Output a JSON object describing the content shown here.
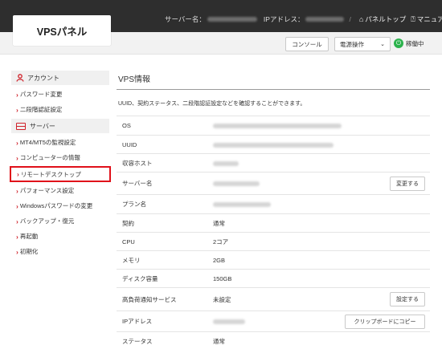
{
  "header": {
    "logo": "VPSパネル",
    "server_name_label": "サーバー名：",
    "ip_label": "IPアドレス：",
    "separator": "/",
    "panel_top_label": "パネルトップ",
    "manual_label": "マニュアル"
  },
  "toolbar": {
    "console_label": "コンソール",
    "power_select_value": "電源操作",
    "status_label": "稼働中",
    "status_color": "#2bb24c"
  },
  "sidebar": {
    "account_heading": "アカウント",
    "account_items": [
      {
        "label": "パスワード変更"
      },
      {
        "label": "二段階認証設定"
      }
    ],
    "server_heading": "サーバー",
    "server_items": [
      {
        "label": "MT4/MT5の監視設定"
      },
      {
        "label": "コンピューターの情報"
      },
      {
        "label": "リモートデスクトップ"
      },
      {
        "label": "パフォーマンス設定"
      },
      {
        "label": "Windowsパスワードの変更"
      },
      {
        "label": "バックアップ・復元"
      },
      {
        "label": "再起動"
      },
      {
        "label": "初期化"
      }
    ],
    "accent_color": "#d0212a",
    "highlight_color": "#e0101a"
  },
  "main": {
    "title": "VPS情報",
    "description": "UUID、契約ステータス、二段階認証設定などを確認することができます。",
    "rows": [
      {
        "key": "OS",
        "value": ""
      },
      {
        "key": "UUID",
        "value": ""
      },
      {
        "key": "収容ホスト",
        "value": ""
      },
      {
        "key": "サーバー名",
        "value": "",
        "action": "変更する"
      },
      {
        "key": "プラン名",
        "value": ""
      },
      {
        "key": "契約",
        "value": "通常"
      },
      {
        "key": "CPU",
        "value": "2コア"
      },
      {
        "key": "メモリ",
        "value": "2GB"
      },
      {
        "key": "ディスク容量",
        "value": "150GB"
      },
      {
        "key": "高負荷通知サービス",
        "value": "未設定",
        "action": "設定する"
      },
      {
        "key": "IPアドレス",
        "value": "",
        "action": "クリップボードにコピー"
      },
      {
        "key": "ステータス",
        "value": "通常"
      }
    ]
  }
}
